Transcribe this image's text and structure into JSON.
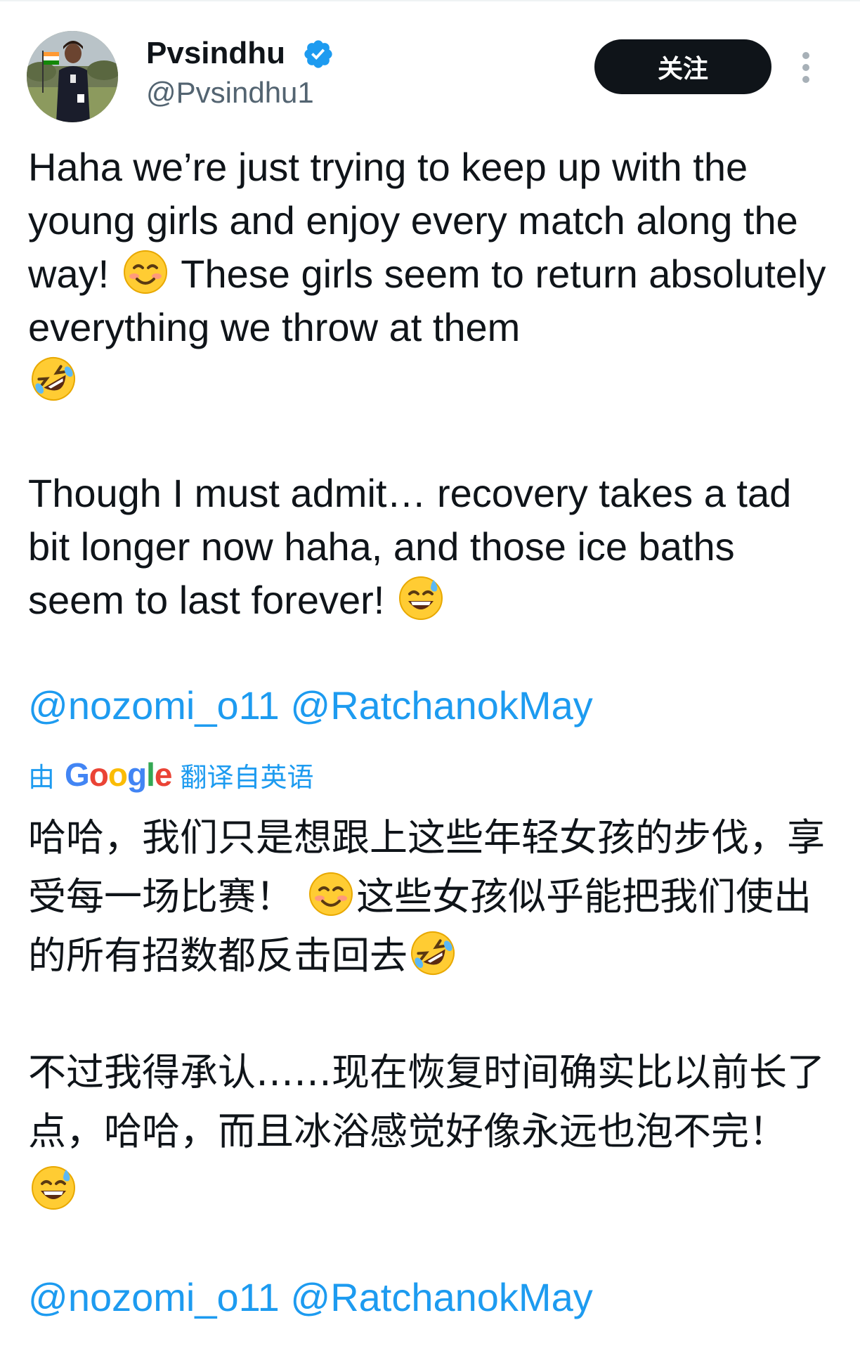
{
  "tweet": {
    "author": {
      "display_name": "Pvsindhu",
      "handle": "@Pvsindhu1",
      "verified": true,
      "verified_icon": "verified-badge-icon",
      "avatar": "profile-photo"
    },
    "follow_label": "关注",
    "more_icon": "more-vertical-icon",
    "text_en": {
      "p1_a": "Haha we’re just trying to keep up with the young girls and enjoy every match along the way! ",
      "p1_emoji1": "smiling-face-icon",
      "p1_b": " These girls seem to return absolutely everything we throw at them",
      "p1_emoji2": "rolling-on-floor-laughing-icon",
      "p2_a": "Though I must admit… recovery takes a tad bit longer now haha, and those ice baths seem to last forever! ",
      "p2_emoji": "grinning-sweat-icon"
    },
    "mentions": [
      "@nozomi_o11",
      "@RatchanokMay"
    ],
    "translation": {
      "prefix": "由",
      "provider_logo": "Google",
      "suffix": "翻译自英语"
    },
    "text_zh": {
      "p1_a": "哈哈，我们只是想跟上这些年轻女孩的步伐，享受每一场比赛！ ",
      "p1_b": "这些女孩似乎能把我们使出的所有招数都反击回去",
      "p2_a": "不过我得承认……现在恢复时间确实比以前长了点，哈哈，而且冰浴感觉好像永远也泡不完！ "
    },
    "colors": {
      "link": "#1d9bf0",
      "text": "#0f1419",
      "secondary": "#536471",
      "button_bg": "#0f1419"
    }
  }
}
